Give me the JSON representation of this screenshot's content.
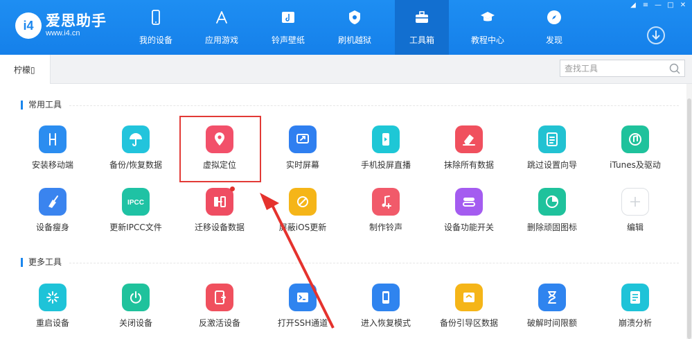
{
  "app": {
    "logo_title": "爱思助手",
    "logo_url": "www.i4.cn",
    "logo_mark": "i4"
  },
  "nav": {
    "items": [
      {
        "label": "我的设备",
        "icon": "phone-icon"
      },
      {
        "label": "应用游戏",
        "icon": "app-store-icon"
      },
      {
        "label": "铃声壁纸",
        "icon": "ringtone-wallpaper-icon"
      },
      {
        "label": "刷机越狱",
        "icon": "flash-jailbreak-icon"
      },
      {
        "label": "工具箱",
        "icon": "toolbox-icon",
        "active": true
      },
      {
        "label": "教程中心",
        "icon": "graduation-cap-icon"
      },
      {
        "label": "发现",
        "icon": "compass-icon"
      }
    ]
  },
  "window": {
    "controls": [
      "shirt-icon",
      "menu-icon",
      "minimize-icon",
      "maximize-icon",
      "close-icon"
    ],
    "download_icon": "download-circle-icon"
  },
  "tabs": {
    "current": "柠檬▯"
  },
  "search": {
    "placeholder": "查找工具"
  },
  "sections": {
    "common": {
      "title": "常用工具",
      "tools": [
        {
          "label": "安装移动端",
          "icon": "install-mobile-icon",
          "color": "#2b8df0"
        },
        {
          "label": "备份/恢复数据",
          "icon": "umbrella-backup-icon",
          "color": "#22c4dc"
        },
        {
          "label": "虚拟定位",
          "icon": "location-pin-icon",
          "color": "#f2506a"
        },
        {
          "label": "实时屏幕",
          "icon": "screen-share-icon",
          "color": "#2f7ff0"
        },
        {
          "label": "手机投屏直播",
          "icon": "phone-cast-icon",
          "color": "#1ec7d6"
        },
        {
          "label": "抹除所有数据",
          "icon": "eraser-icon",
          "color": "#f0505e"
        },
        {
          "label": "跳过设置向导",
          "icon": "skip-setup-icon",
          "color": "#22c2d2"
        },
        {
          "label": "iTunes及驱动",
          "icon": "itunes-music-icon",
          "color": "#1fc29c"
        },
        {
          "label": "设备瘦身",
          "icon": "broom-icon",
          "color": "#3a84ef"
        },
        {
          "label": "更新IPCC文件",
          "icon": "ipcc-icon",
          "color": "#1fc2a4"
        },
        {
          "label": "迁移设备数据",
          "icon": "migrate-data-icon",
          "color": "#ef4d62"
        },
        {
          "label": "屏蔽iOS更新",
          "icon": "block-update-icon",
          "color": "#f5b518"
        },
        {
          "label": "制作铃声",
          "icon": "music-note-icon",
          "color": "#f15a6a"
        },
        {
          "label": "设备功能开关",
          "icon": "toggle-switch-icon",
          "color": "#a45cf0"
        },
        {
          "label": "删除顽固图标",
          "icon": "delete-icon-clock-icon",
          "color": "#1fc29c"
        },
        {
          "label": "编辑",
          "icon": "plus-icon",
          "color": "#ffffff"
        }
      ]
    },
    "more": {
      "title": "更多工具",
      "tools": [
        {
          "label": "重启设备",
          "icon": "restart-icon",
          "color": "#1ec3d8"
        },
        {
          "label": "关闭设备",
          "icon": "power-icon",
          "color": "#1fc29c"
        },
        {
          "label": "反激活设备",
          "icon": "deactivate-icon",
          "color": "#f0505e"
        },
        {
          "label": "打开SSH通道",
          "icon": "terminal-icon",
          "color": "#2f84ef"
        },
        {
          "label": "进入恢复模式",
          "icon": "recovery-mode-icon",
          "color": "#2f84ef"
        },
        {
          "label": "备份引导区数据",
          "icon": "backup-boot-icon",
          "color": "#f5b518"
        },
        {
          "label": "破解时间限额",
          "icon": "hourglass-icon",
          "color": "#2f84ef"
        },
        {
          "label": "崩溃分析",
          "icon": "crash-report-icon",
          "color": "#1ec3d8"
        }
      ]
    }
  }
}
